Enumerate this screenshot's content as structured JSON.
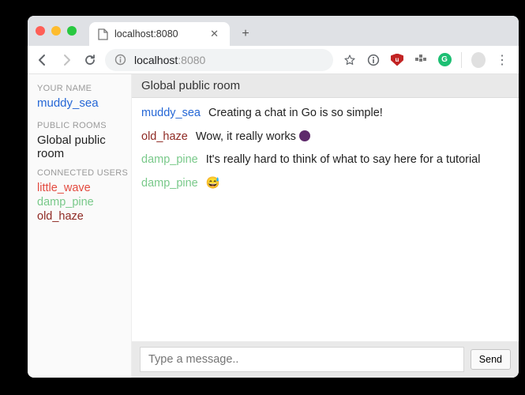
{
  "browser": {
    "tab": {
      "title": "localhost:8080"
    },
    "address": {
      "host": "localhost",
      "port": ":8080"
    }
  },
  "sidebar": {
    "labels": {
      "your_name": "YOUR NAME",
      "public_rooms": "PUBLIC ROOMS",
      "connected_users": "CONNECTED USERS"
    },
    "my_name": "muddy_sea",
    "rooms": [
      {
        "name": "Global public room"
      }
    ],
    "users": [
      {
        "name": "little_wave",
        "color_class": "c-red"
      },
      {
        "name": "damp_pine",
        "color_class": "c-lightgreen"
      },
      {
        "name": "old_haze",
        "color_class": "c-darkred"
      }
    ]
  },
  "chat": {
    "room_title": "Global public room",
    "messages": [
      {
        "author": "muddy_sea",
        "color_class": "c-blue",
        "text": "Creating a chat in Go is so simple!"
      },
      {
        "author": "old_haze",
        "color_class": "c-darkred",
        "text": "Wow, it really works ",
        "trailing_emoji": "circle"
      },
      {
        "author": "damp_pine",
        "color_class": "c-lightgreen",
        "text": "It's really hard to think of what to say here for a tutorial"
      },
      {
        "author": "damp_pine",
        "color_class": "c-lightgreen",
        "text": "😅"
      }
    ],
    "compose": {
      "placeholder": "Type a message..",
      "send_label": "Send"
    }
  }
}
